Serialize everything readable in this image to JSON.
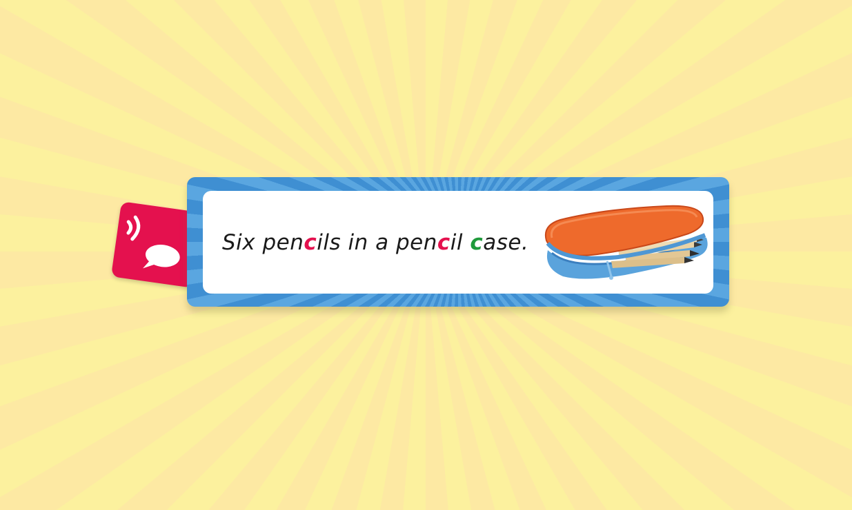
{
  "sentence": {
    "segments": [
      {
        "text": "Six pen",
        "style": "normal"
      },
      {
        "text": "c",
        "style": "red"
      },
      {
        "text": "ils in a pen",
        "style": "normal"
      },
      {
        "text": "c",
        "style": "red"
      },
      {
        "text": "il ",
        "style": "normal"
      },
      {
        "text": "c",
        "style": "green"
      },
      {
        "text": "ase.",
        "style": "normal"
      }
    ]
  },
  "audio_button": {
    "icon": "speech-audio-icon"
  },
  "image": {
    "icon": "pencil-case-icon"
  },
  "colors": {
    "tab_red": "#e4114e",
    "highlight_red": "#e4114e",
    "highlight_green": "#1f9a3b",
    "frame_blue": "#4a9ad8",
    "background_yellow": "#fdf2a6"
  }
}
